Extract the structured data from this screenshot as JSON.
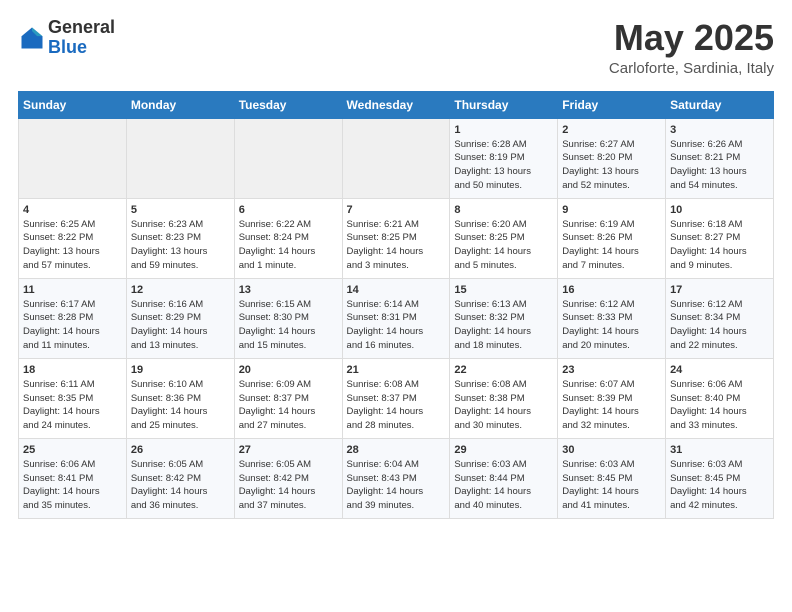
{
  "header": {
    "logo_general": "General",
    "logo_blue": "Blue",
    "month_title": "May 2025",
    "location": "Carloforte, Sardinia, Italy"
  },
  "days_of_week": [
    "Sunday",
    "Monday",
    "Tuesday",
    "Wednesday",
    "Thursday",
    "Friday",
    "Saturday"
  ],
  "weeks": [
    [
      {
        "day": "",
        "info": ""
      },
      {
        "day": "",
        "info": ""
      },
      {
        "day": "",
        "info": ""
      },
      {
        "day": "",
        "info": ""
      },
      {
        "day": "1",
        "info": "Sunrise: 6:28 AM\nSunset: 8:19 PM\nDaylight: 13 hours\nand 50 minutes."
      },
      {
        "day": "2",
        "info": "Sunrise: 6:27 AM\nSunset: 8:20 PM\nDaylight: 13 hours\nand 52 minutes."
      },
      {
        "day": "3",
        "info": "Sunrise: 6:26 AM\nSunset: 8:21 PM\nDaylight: 13 hours\nand 54 minutes."
      }
    ],
    [
      {
        "day": "4",
        "info": "Sunrise: 6:25 AM\nSunset: 8:22 PM\nDaylight: 13 hours\nand 57 minutes."
      },
      {
        "day": "5",
        "info": "Sunrise: 6:23 AM\nSunset: 8:23 PM\nDaylight: 13 hours\nand 59 minutes."
      },
      {
        "day": "6",
        "info": "Sunrise: 6:22 AM\nSunset: 8:24 PM\nDaylight: 14 hours\nand 1 minute."
      },
      {
        "day": "7",
        "info": "Sunrise: 6:21 AM\nSunset: 8:25 PM\nDaylight: 14 hours\nand 3 minutes."
      },
      {
        "day": "8",
        "info": "Sunrise: 6:20 AM\nSunset: 8:25 PM\nDaylight: 14 hours\nand 5 minutes."
      },
      {
        "day": "9",
        "info": "Sunrise: 6:19 AM\nSunset: 8:26 PM\nDaylight: 14 hours\nand 7 minutes."
      },
      {
        "day": "10",
        "info": "Sunrise: 6:18 AM\nSunset: 8:27 PM\nDaylight: 14 hours\nand 9 minutes."
      }
    ],
    [
      {
        "day": "11",
        "info": "Sunrise: 6:17 AM\nSunset: 8:28 PM\nDaylight: 14 hours\nand 11 minutes."
      },
      {
        "day": "12",
        "info": "Sunrise: 6:16 AM\nSunset: 8:29 PM\nDaylight: 14 hours\nand 13 minutes."
      },
      {
        "day": "13",
        "info": "Sunrise: 6:15 AM\nSunset: 8:30 PM\nDaylight: 14 hours\nand 15 minutes."
      },
      {
        "day": "14",
        "info": "Sunrise: 6:14 AM\nSunset: 8:31 PM\nDaylight: 14 hours\nand 16 minutes."
      },
      {
        "day": "15",
        "info": "Sunrise: 6:13 AM\nSunset: 8:32 PM\nDaylight: 14 hours\nand 18 minutes."
      },
      {
        "day": "16",
        "info": "Sunrise: 6:12 AM\nSunset: 8:33 PM\nDaylight: 14 hours\nand 20 minutes."
      },
      {
        "day": "17",
        "info": "Sunrise: 6:12 AM\nSunset: 8:34 PM\nDaylight: 14 hours\nand 22 minutes."
      }
    ],
    [
      {
        "day": "18",
        "info": "Sunrise: 6:11 AM\nSunset: 8:35 PM\nDaylight: 14 hours\nand 24 minutes."
      },
      {
        "day": "19",
        "info": "Sunrise: 6:10 AM\nSunset: 8:36 PM\nDaylight: 14 hours\nand 25 minutes."
      },
      {
        "day": "20",
        "info": "Sunrise: 6:09 AM\nSunset: 8:37 PM\nDaylight: 14 hours\nand 27 minutes."
      },
      {
        "day": "21",
        "info": "Sunrise: 6:08 AM\nSunset: 8:37 PM\nDaylight: 14 hours\nand 28 minutes."
      },
      {
        "day": "22",
        "info": "Sunrise: 6:08 AM\nSunset: 8:38 PM\nDaylight: 14 hours\nand 30 minutes."
      },
      {
        "day": "23",
        "info": "Sunrise: 6:07 AM\nSunset: 8:39 PM\nDaylight: 14 hours\nand 32 minutes."
      },
      {
        "day": "24",
        "info": "Sunrise: 6:06 AM\nSunset: 8:40 PM\nDaylight: 14 hours\nand 33 minutes."
      }
    ],
    [
      {
        "day": "25",
        "info": "Sunrise: 6:06 AM\nSunset: 8:41 PM\nDaylight: 14 hours\nand 35 minutes."
      },
      {
        "day": "26",
        "info": "Sunrise: 6:05 AM\nSunset: 8:42 PM\nDaylight: 14 hours\nand 36 minutes."
      },
      {
        "day": "27",
        "info": "Sunrise: 6:05 AM\nSunset: 8:42 PM\nDaylight: 14 hours\nand 37 minutes."
      },
      {
        "day": "28",
        "info": "Sunrise: 6:04 AM\nSunset: 8:43 PM\nDaylight: 14 hours\nand 39 minutes."
      },
      {
        "day": "29",
        "info": "Sunrise: 6:03 AM\nSunset: 8:44 PM\nDaylight: 14 hours\nand 40 minutes."
      },
      {
        "day": "30",
        "info": "Sunrise: 6:03 AM\nSunset: 8:45 PM\nDaylight: 14 hours\nand 41 minutes."
      },
      {
        "day": "31",
        "info": "Sunrise: 6:03 AM\nSunset: 8:45 PM\nDaylight: 14 hours\nand 42 minutes."
      }
    ]
  ]
}
